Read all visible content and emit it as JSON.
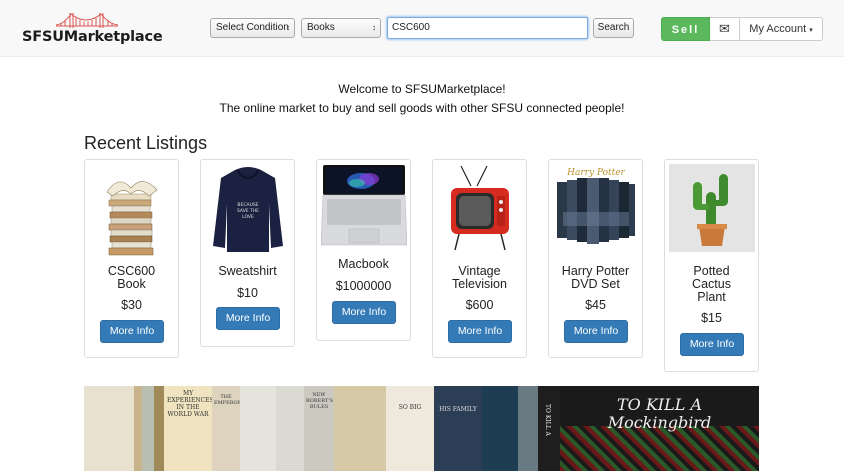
{
  "header": {
    "logo_text": "SFSUMarketplace",
    "condition_select": "Select Condition",
    "category_select": "Books",
    "search_value": "CSC600",
    "search_label": "Search",
    "sell_label": "Sell",
    "account_label": "My Account"
  },
  "welcome": {
    "line1": "Welcome to SFSUMarketplace!",
    "line2": "The online market to buy and sell goods with other SFSU connected people!"
  },
  "recent": {
    "title": "Recent Listings",
    "more_label": "More Info",
    "listings": [
      {
        "title": "CSC600 Book",
        "price": "$30"
      },
      {
        "title": "Sweatshirt",
        "price": "$10"
      },
      {
        "title": "Macbook",
        "price": "$1000000"
      },
      {
        "title": "Vintage Television",
        "price": "$600"
      },
      {
        "title": "Harry Potter DVD Set",
        "price": "$45"
      },
      {
        "title": "Potted Cactus Plant",
        "price": "$15"
      }
    ]
  },
  "banner": {
    "book_titles": [
      "MY EXPERIENCES IN THE WORLD WAR",
      "THE EMPEROR",
      "NEW ROBERT'S RULES",
      "SO BIG",
      "HIS FAMILY",
      "TO KILL A",
      "TO KILL A Mockingbird"
    ]
  },
  "colors": {
    "sell_green": "#5cb85c",
    "button_blue": "#337ab7",
    "navbar_bg": "#f8f8f8"
  },
  "icons": [
    "bridge-logo-icon",
    "envelope-icon",
    "caret-down-icon"
  ]
}
